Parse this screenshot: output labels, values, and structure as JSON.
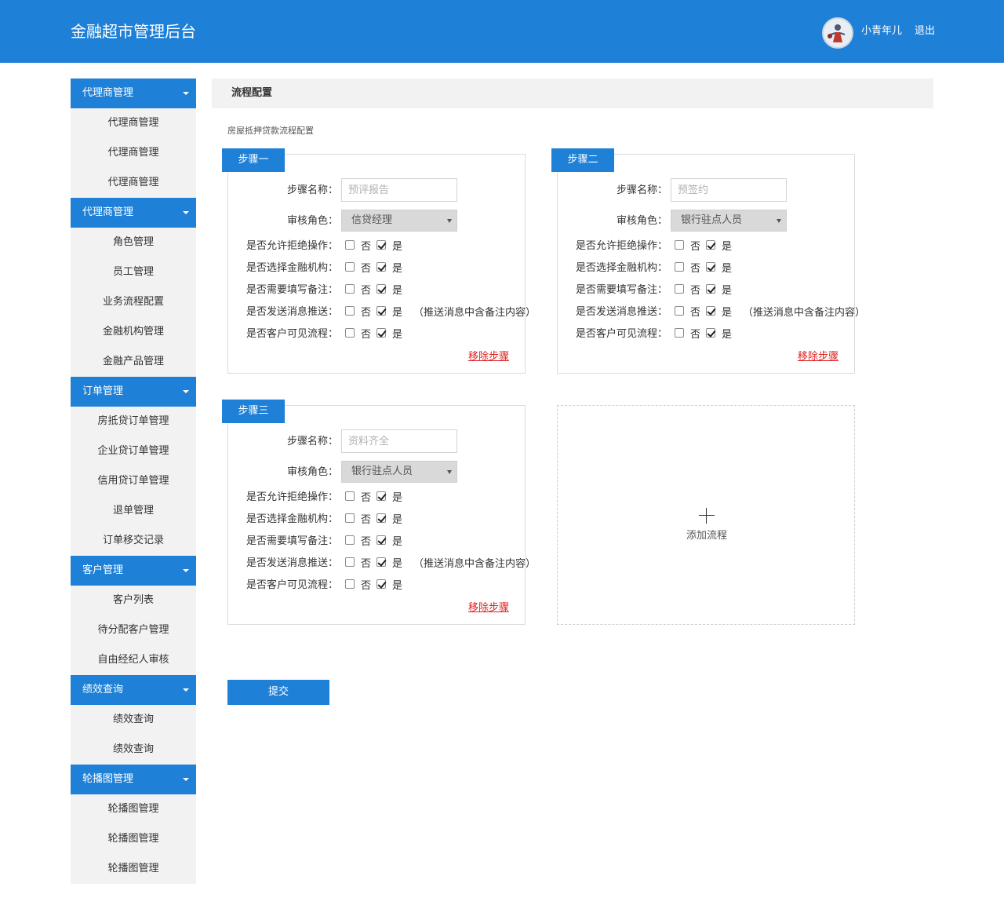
{
  "header": {
    "title": "金融超市管理后台",
    "user_name": "小青年儿",
    "logout": "退出"
  },
  "sidebar": {
    "groups": [
      {
        "label": "代理商管理",
        "items": [
          "代理商管理",
          "代理商管理",
          "代理商管理"
        ]
      },
      {
        "label": "代理商管理",
        "items": [
          "角色管理",
          "员工管理",
          "业务流程配置",
          "金融机构管理",
          "金融产品管理"
        ]
      },
      {
        "label": "订单管理",
        "items": [
          "房抵贷订单管理",
          "企业贷订单管理",
          "信用贷订单管理",
          "退单管理",
          "订单移交记录"
        ]
      },
      {
        "label": "客户管理",
        "items": [
          "客户列表",
          "待分配客户管理",
          "自由经纪人审核"
        ]
      },
      {
        "label": "绩效查询",
        "items": [
          "绩效查询",
          "绩效查询"
        ]
      },
      {
        "label": "轮播图管理",
        "items": [
          "轮播图管理",
          "轮播图管理",
          "轮播图管理"
        ]
      }
    ]
  },
  "main": {
    "title": "流程配置",
    "subtitle": "房屋抵押贷款流程配置",
    "labels": {
      "step_name": "步骤名称：",
      "role": "审核角色：",
      "allow_reject": "是否允许拒绝操作：",
      "choose_org": "是否选择金融机构：",
      "need_remark": "是否需要填写备注：",
      "send_push": "是否发送消息推送：",
      "customer_visible": "是否客户可见流程：",
      "no": "否",
      "yes": "是",
      "push_note": "（推送消息中含备注内容）",
      "remove": "移除步骤"
    },
    "steps": [
      {
        "tag": "步骤一",
        "name_placeholder": "预评报告",
        "role": "信贷经理",
        "options": {
          "allow_reject": "yes",
          "choose_org": "yes",
          "need_remark": "yes",
          "send_push": "yes",
          "customer_visible": "yes"
        }
      },
      {
        "tag": "步骤二",
        "name_placeholder": "预签约",
        "role": "银行驻点人员",
        "options": {
          "allow_reject": "yes",
          "choose_org": "yes",
          "need_remark": "yes",
          "send_push": "yes",
          "customer_visible": "yes"
        }
      },
      {
        "tag": "步骤三",
        "name_placeholder": "资料齐全",
        "role": "银行驻点人员",
        "options": {
          "allow_reject": "yes",
          "choose_org": "yes",
          "need_remark": "yes",
          "send_push": "yes",
          "customer_visible": "yes"
        }
      }
    ],
    "add_step": "添加流程",
    "submit": "提交"
  }
}
